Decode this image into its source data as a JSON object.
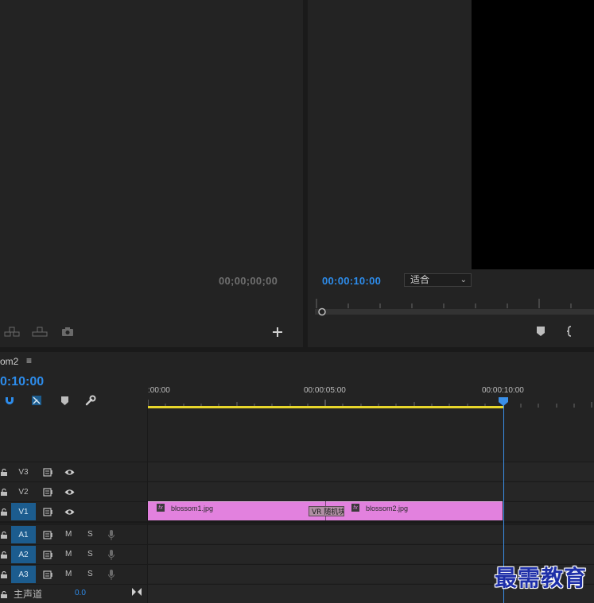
{
  "source_monitor": {
    "timecode": "00;00;00;00"
  },
  "program_monitor": {
    "timecode": "00:00:10:00",
    "fit_label": "适合"
  },
  "timeline": {
    "sequence_name": "om2",
    "menu_glyph": "≡",
    "timecode": "0:10:00",
    "ruler": [
      ":00:00",
      "00:00:05:00",
      "00:00:10:00"
    ],
    "tracks": [
      {
        "id": "V3",
        "label": "V3",
        "active": false
      },
      {
        "id": "V2",
        "label": "V2",
        "active": false
      },
      {
        "id": "V1",
        "label": "V1",
        "active": true
      },
      {
        "id": "A1",
        "label": "A1",
        "active": true,
        "m": "M",
        "s": "S"
      },
      {
        "id": "A2",
        "label": "A2",
        "active": true,
        "m": "M",
        "s": "S"
      },
      {
        "id": "A3",
        "label": "A3",
        "active": true,
        "m": "M",
        "s": "S"
      }
    ],
    "clips": [
      {
        "name": "blossom1.jpg",
        "fx": "fx"
      },
      {
        "name": "blossom2.jpg",
        "fx": "fx"
      }
    ],
    "transition_label": "VR 随机块",
    "master": {
      "label": "主声道",
      "value": "0.0"
    }
  },
  "watermark": "最需教育",
  "colors": {
    "accent": "#2d8ceb",
    "clip": "#e281de",
    "work_area": "#e7d62b",
    "track_active": "#1c5c8e"
  }
}
